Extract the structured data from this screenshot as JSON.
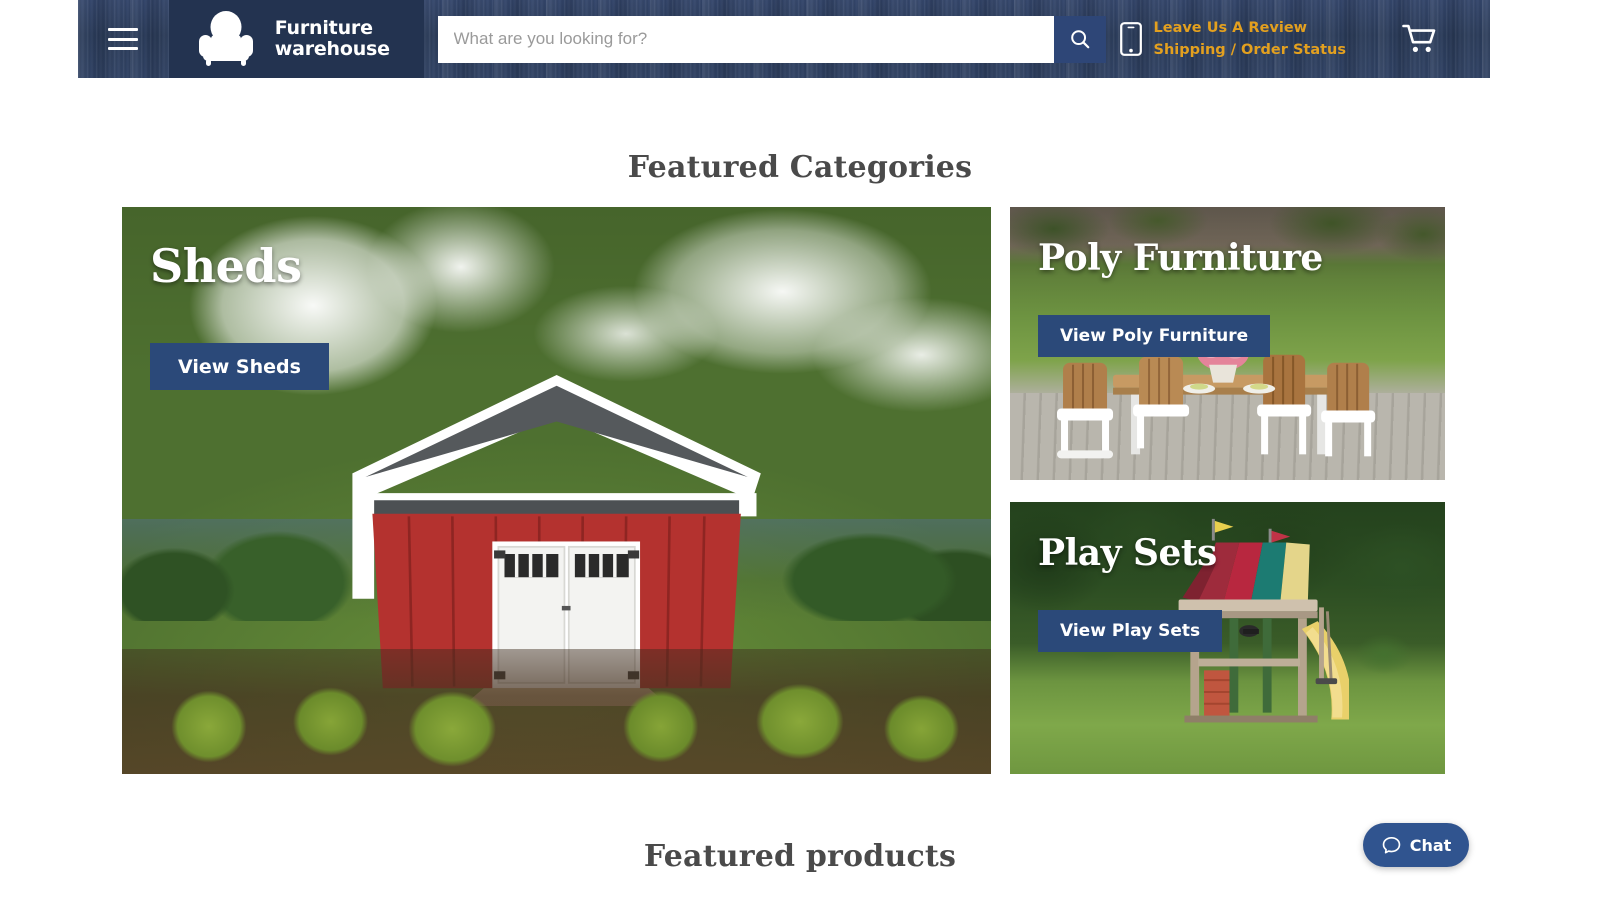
{
  "header": {
    "menu_icon": "hamburger-menu-icon",
    "logo": {
      "icon": "armchair-logo-icon",
      "line1": "Furniture",
      "line2": "warehouse"
    },
    "search": {
      "placeholder": "What are you looking for?",
      "value": "",
      "button_icon": "search-icon"
    },
    "phone_icon": "mobile-phone-icon",
    "links": [
      {
        "label": "Leave Us A Review"
      },
      {
        "label": "Shipping / Order Status"
      }
    ],
    "cart_icon": "shopping-cart-icon",
    "colors": {
      "background_navy": "#2b3d5c",
      "logo_block_navy": "#233350",
      "link_gold": "#e3a01f",
      "search_button_blue": "#2e4677"
    }
  },
  "sections": {
    "featured_categories_title": "Featured Categories",
    "featured_products_title": "Featured products"
  },
  "categories": [
    {
      "id": "sheds",
      "title": "Sheds",
      "button_label": "View Sheds",
      "image_description": "red barn-style shed with gray shingled gambrel roof, white double doors, blue sky with clouds, green lawn and shrubs"
    },
    {
      "id": "poly-furniture",
      "title": "Poly Furniture",
      "button_label": "View Poly Furniture",
      "image_description": "outdoor poly dining set with brown adirondack-style chairs and wooden table on a gray deck with green lawn behind"
    },
    {
      "id": "play-sets",
      "title": "Play Sets",
      "button_label": "View Play Sets",
      "image_description": "wooden playset with red, teal and yellow striped canopy roof, yellow slide and swing in a grassy backyard with trees"
    }
  ],
  "chat": {
    "label": "Chat",
    "icon": "chat-bubble-icon",
    "accent_color": "#30548f"
  }
}
